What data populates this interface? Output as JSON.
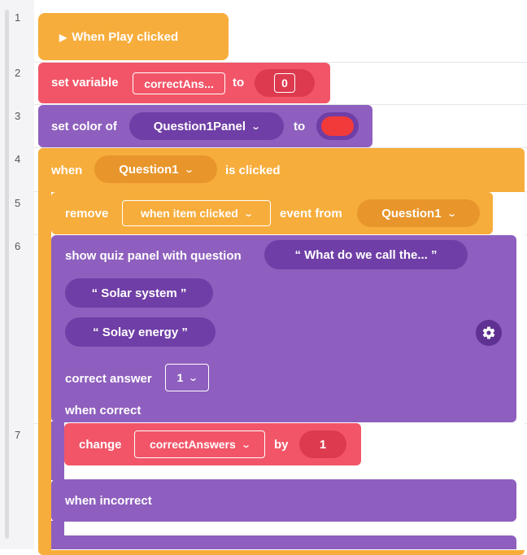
{
  "line_numbers": [
    "1",
    "2",
    "3",
    "4",
    "5",
    "6",
    "7"
  ],
  "blocks": {
    "play": {
      "label": "When Play clicked",
      "icon": "play-icon"
    },
    "set_variable": {
      "label": "set variable",
      "variable": "correctAns...",
      "to_label": "to",
      "value": "0"
    },
    "set_color": {
      "label": "set color of",
      "target": "Question1Panel",
      "to_label": "to",
      "color": "#f23a3a"
    },
    "when_clicked": {
      "when_label": "when",
      "target": "Question1",
      "suffix": "is clicked"
    },
    "remove_event": {
      "label": "remove",
      "event": "when item clicked",
      "from_label": "event from",
      "target": "Question1"
    },
    "quiz": {
      "label": "show quiz panel with question",
      "question": "“ What do we call the... ”",
      "answers": [
        "“ Solar system ”",
        "“ Solay energy ”"
      ],
      "correct_label": "correct answer",
      "correct_value": "1",
      "when_correct": "when correct",
      "when_incorrect": "when incorrect",
      "settings_icon": "gear-icon"
    },
    "change": {
      "label": "change",
      "variable": "correctAnswers",
      "by_label": "by",
      "value": "1"
    }
  },
  "colors": {
    "events": "#f7ad3b",
    "variables": "#f25568",
    "ui": "#8e5fbe"
  }
}
